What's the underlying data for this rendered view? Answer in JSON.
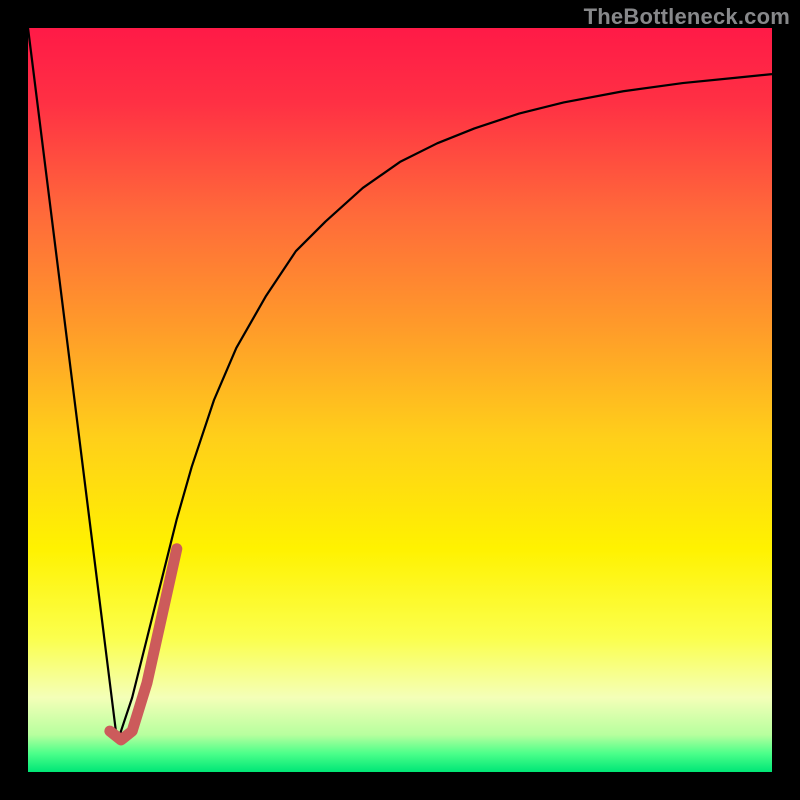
{
  "watermark": "TheBottleneck.com",
  "chart_data": {
    "type": "line",
    "title": "",
    "xlabel": "",
    "ylabel": "",
    "xlim": [
      0,
      100
    ],
    "ylim": [
      0,
      100
    ],
    "grid": false,
    "gradient": {
      "stops": [
        {
          "offset": 0.0,
          "color": "#ff1a47"
        },
        {
          "offset": 0.1,
          "color": "#ff3044"
        },
        {
          "offset": 0.25,
          "color": "#ff6a3a"
        },
        {
          "offset": 0.4,
          "color": "#ff9a2a"
        },
        {
          "offset": 0.55,
          "color": "#ffcf1a"
        },
        {
          "offset": 0.7,
          "color": "#fff200"
        },
        {
          "offset": 0.82,
          "color": "#fbff4d"
        },
        {
          "offset": 0.9,
          "color": "#f4ffb8"
        },
        {
          "offset": 0.95,
          "color": "#b7ff9e"
        },
        {
          "offset": 0.975,
          "color": "#4cff8a"
        },
        {
          "offset": 1.0,
          "color": "#00e676"
        }
      ]
    },
    "series": [
      {
        "name": "left-line",
        "role": "bottleneck-curve-left",
        "stroke": "#000000",
        "stroke_width": 2.2,
        "x": [
          0,
          12
        ],
        "values": [
          100,
          4
        ]
      },
      {
        "name": "right-curve",
        "role": "bottleneck-curve-right",
        "stroke": "#000000",
        "stroke_width": 2.2,
        "x": [
          12,
          14,
          16,
          18,
          20,
          22,
          25,
          28,
          32,
          36,
          40,
          45,
          50,
          55,
          60,
          66,
          72,
          80,
          88,
          95,
          100
        ],
        "values": [
          4,
          10,
          18,
          26,
          34,
          41,
          50,
          57,
          64,
          70,
          74,
          78.5,
          82,
          84.5,
          86.5,
          88.5,
          90,
          91.5,
          92.6,
          93.3,
          93.8
        ]
      },
      {
        "name": "marker-j",
        "role": "highlight-hook",
        "stroke": "#cc5b5b",
        "stroke_width": 11,
        "linecap": "round",
        "x": [
          11,
          12.5,
          14,
          16,
          18,
          20
        ],
        "values": [
          5.5,
          4.3,
          5.5,
          12,
          21,
          30
        ]
      }
    ]
  }
}
